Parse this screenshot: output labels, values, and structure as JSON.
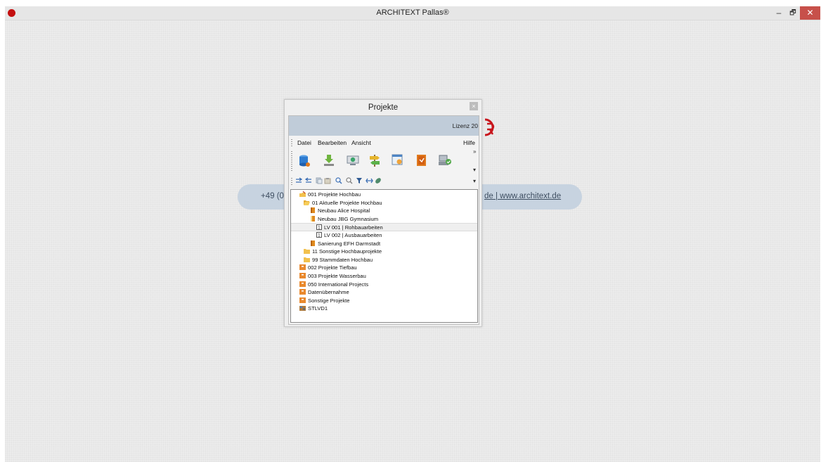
{
  "window": {
    "title": "ARCHITEXT Pallas®",
    "minimize": "–",
    "maximize": "🗗",
    "close": "✕"
  },
  "background": {
    "contact_left": "+49 (0",
    "contact_right": "de | www.architext.de"
  },
  "dialog": {
    "title": "Projekte",
    "close": "×",
    "license": "Lizenz 20",
    "menu": {
      "datei": "Datei",
      "bearbeiten": "Bearbeiten",
      "ansicht": "Ansicht",
      "hilfe": "Hilfe"
    },
    "toolbar_overflow": "»"
  },
  "tree": {
    "items": [
      {
        "label": "001 Projekte Hochbau",
        "icon": "folder-hand-icon"
      },
      {
        "label": "01 Aktuelle Projekte Hochbau",
        "icon": "folder-open-icon"
      },
      {
        "label": "Neubau Alice Hospital",
        "icon": "book-icon"
      },
      {
        "label": "Neubau JBG Gymnasium",
        "icon": "book-open-icon"
      },
      {
        "label": "LV 001 | Rohbauarbeiten",
        "icon": "lv-doc-icon"
      },
      {
        "label": "LV 002 | Ausbauarbeiten",
        "icon": "lv-doc-icon"
      },
      {
        "label": "Sanierung EFH Darmstadt",
        "icon": "book-icon"
      },
      {
        "label": "11 Sonstige Hochbauprojekte",
        "icon": "folder-icon"
      },
      {
        "label": "99 Stammdaten Hochbau",
        "icon": "folder-icon"
      },
      {
        "label": "002 Projekte Tiefbau",
        "icon": "drawer-icon"
      },
      {
        "label": "003 Projekte Wasserbau",
        "icon": "drawer-icon"
      },
      {
        "label": "050 International Projects",
        "icon": "drawer-icon"
      },
      {
        "label": "Datenübernahme",
        "icon": "drawer-icon"
      },
      {
        "label": "Sonstige Projekte",
        "icon": "drawer-icon"
      },
      {
        "label": "STLVD1",
        "icon": "stlb-icon"
      }
    ]
  },
  "colors": {
    "accent_red": "#c40f0f",
    "license_band": "#c0ccd9",
    "contact_pill": "#c7d3e0",
    "folder_yellow": "#f2c14e",
    "book_orange": "#e08a1e",
    "drawer_orange": "#e9892d"
  }
}
